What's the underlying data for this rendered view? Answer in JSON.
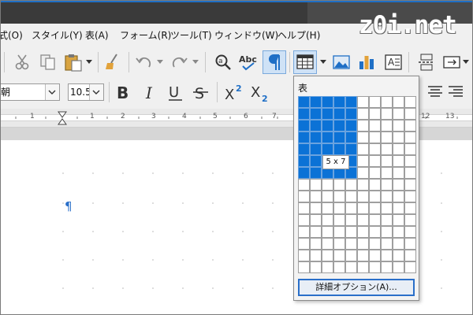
{
  "watermark": "z0i.net",
  "menu": [
    {
      "label": "式(O)"
    },
    {
      "label": "スタイル(Y)"
    },
    {
      "label": "表(A)"
    },
    {
      "label": "フォーム(R)"
    },
    {
      "label": "ツール(T)"
    },
    {
      "label": "ウィンドウ(W)"
    },
    {
      "label": "ヘルプ(H)"
    }
  ],
  "format_bar": {
    "font_name": "朝",
    "font_size": "10.5"
  },
  "ruler": {
    "numbers": [
      "1",
      "1",
      "2",
      "3",
      "4",
      "5",
      "6",
      "7",
      "12",
      "13"
    ]
  },
  "table_popup": {
    "title": "表",
    "grid_columns": 10,
    "grid_rows": 15,
    "selected_columns": 5,
    "selected_rows": 7,
    "size_label": "5 x 7",
    "more_options_label": "詳細オプション(A)..."
  },
  "document": {
    "paragraph_mark": "¶"
  },
  "colors": {
    "titlebar": "#3a3a3a",
    "accent": "#1f6fc6",
    "selected_cell": "#0b72d6"
  }
}
